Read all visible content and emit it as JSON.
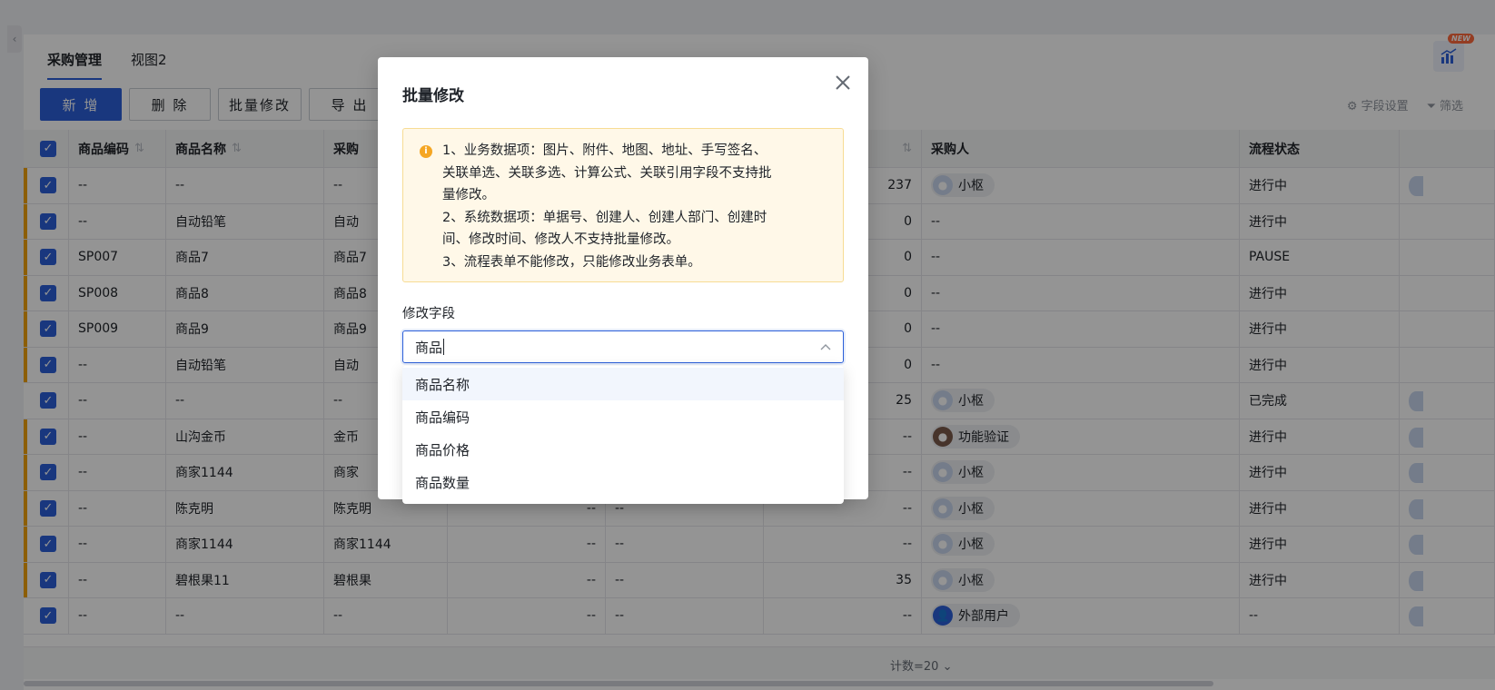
{
  "tabs": [
    {
      "label": "采购管理",
      "active": true
    },
    {
      "label": "视图2",
      "active": false
    }
  ],
  "new_badge": "NEW",
  "toolbar": {
    "add": "新 增",
    "delete": "删 除",
    "batch_edit": "批量修改",
    "export": "导 出",
    "field_settings": "字段设置",
    "filter": "筛选"
  },
  "table": {
    "headers": {
      "code": "商品编码",
      "name": "商品名称",
      "col3": "采购",
      "buyer": "采购人",
      "status": "流程状态"
    },
    "rows": [
      {
        "code": "--",
        "name": "--",
        "col3": "--",
        "qty": "237",
        "buyer": "小枢",
        "avatar": "default",
        "status": "进行中",
        "marked": true
      },
      {
        "code": "--",
        "name": "自动铅笔",
        "col3": "自动",
        "qty": "0",
        "buyer": "--",
        "avatar": "",
        "status": "进行中",
        "marked": true
      },
      {
        "code": "SP007",
        "name": "商品7",
        "col3": "商品7",
        "qty": "0",
        "buyer": "--",
        "avatar": "",
        "status": "PAUSE",
        "marked": true
      },
      {
        "code": "SP008",
        "name": "商品8",
        "col3": "商品8",
        "qty": "0",
        "buyer": "--",
        "avatar": "",
        "status": "进行中",
        "marked": true
      },
      {
        "code": "SP009",
        "name": "商品9",
        "col3": "商品9",
        "qty": "0",
        "buyer": "--",
        "avatar": "",
        "status": "进行中",
        "marked": true
      },
      {
        "code": "--",
        "name": "自动铅笔",
        "col3": "自动",
        "qty": "0",
        "buyer": "--",
        "avatar": "",
        "status": "进行中",
        "marked": true
      },
      {
        "code": "--",
        "name": "--",
        "col3": "--",
        "qty": "25",
        "buyer": "小枢",
        "avatar": "default",
        "status": "已完成",
        "marked": false
      },
      {
        "code": "--",
        "name": "山沟金币",
        "col3": "金币",
        "qty": "--",
        "buyer": "功能验证",
        "avatar": "photo",
        "status": "进行中",
        "marked": true
      },
      {
        "code": "--",
        "name": "商家1144",
        "col3": "商家",
        "qty": "--",
        "buyer": "小枢",
        "avatar": "default",
        "status": "进行中",
        "marked": true
      },
      {
        "code": "--",
        "name": "陈克明",
        "col3": "陈克明",
        "colA": "--",
        "colB": "--",
        "qty": "--",
        "buyer": "小枢",
        "avatar": "default",
        "status": "进行中",
        "marked": true
      },
      {
        "code": "--",
        "name": "商家1144",
        "col3": "商家1144",
        "colA": "--",
        "colB": "--",
        "qty": "--",
        "buyer": "小枢",
        "avatar": "default",
        "status": "进行中",
        "marked": true
      },
      {
        "code": "--",
        "name": "碧根果11",
        "col3": "碧根果",
        "colA": "--",
        "colB": "--",
        "qty": "35",
        "buyer": "小枢",
        "avatar": "default",
        "status": "进行中",
        "marked": true
      },
      {
        "code": "--",
        "name": "--",
        "col3": "--",
        "colA": "--",
        "colB": "--",
        "qty": "--",
        "buyer": "外部用户",
        "avatar": "blue",
        "status": "--",
        "marked": false
      }
    ]
  },
  "footer": {
    "count": "计数=20"
  },
  "modal": {
    "title": "批量修改",
    "notice_lines": [
      "1、业务数据项：图片、附件、地图、地址、手写签名、",
      "关联单选、关联多选、计算公式、关联引用字段不支持批",
      "量修改。",
      "2、系统数据项：单据号、创建人、创建人部门、创建时",
      "间、修改时间、修改人不支持批量修改。",
      "3、流程表单不能修改，只能修改业务表单。"
    ],
    "field_label": "修改字段",
    "select_value": "商品",
    "options": [
      "商品名称",
      "商品编码",
      "商品价格",
      "商品数量"
    ]
  },
  "colors": {
    "primary": "#2b5fd9",
    "row_mark": "#f2a30b",
    "notice_bg": "#fff8e8",
    "notice_border": "#f7dc94"
  }
}
